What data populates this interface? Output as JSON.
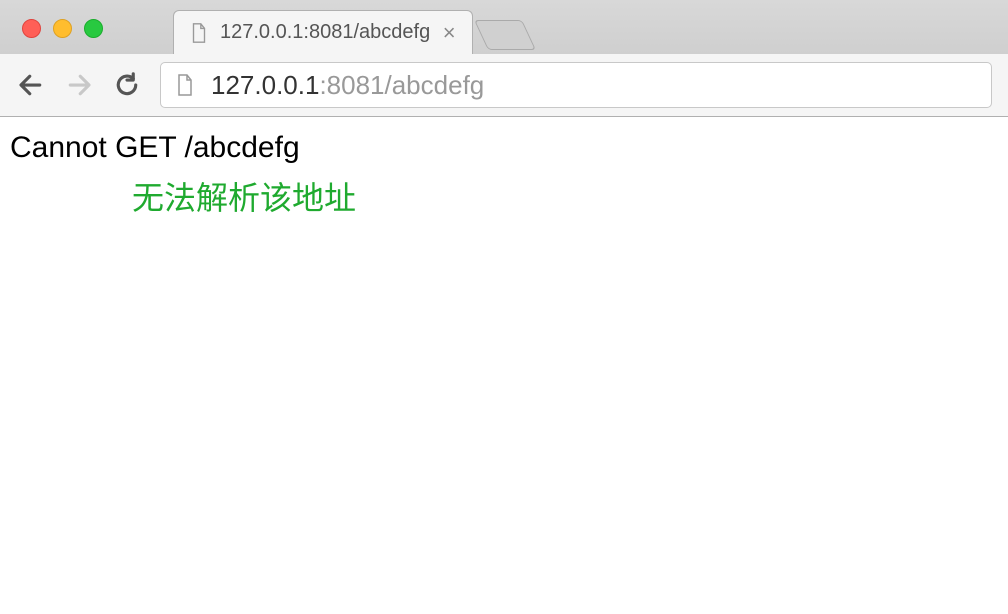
{
  "tab": {
    "title": "127.0.0.1:8081/abcdefg"
  },
  "address": {
    "host": "127.0.0.1",
    "port_path": ":8081/abcdefg"
  },
  "page": {
    "error_text": "Cannot GET /abcdefg",
    "annotation": "无法解析该地址"
  }
}
